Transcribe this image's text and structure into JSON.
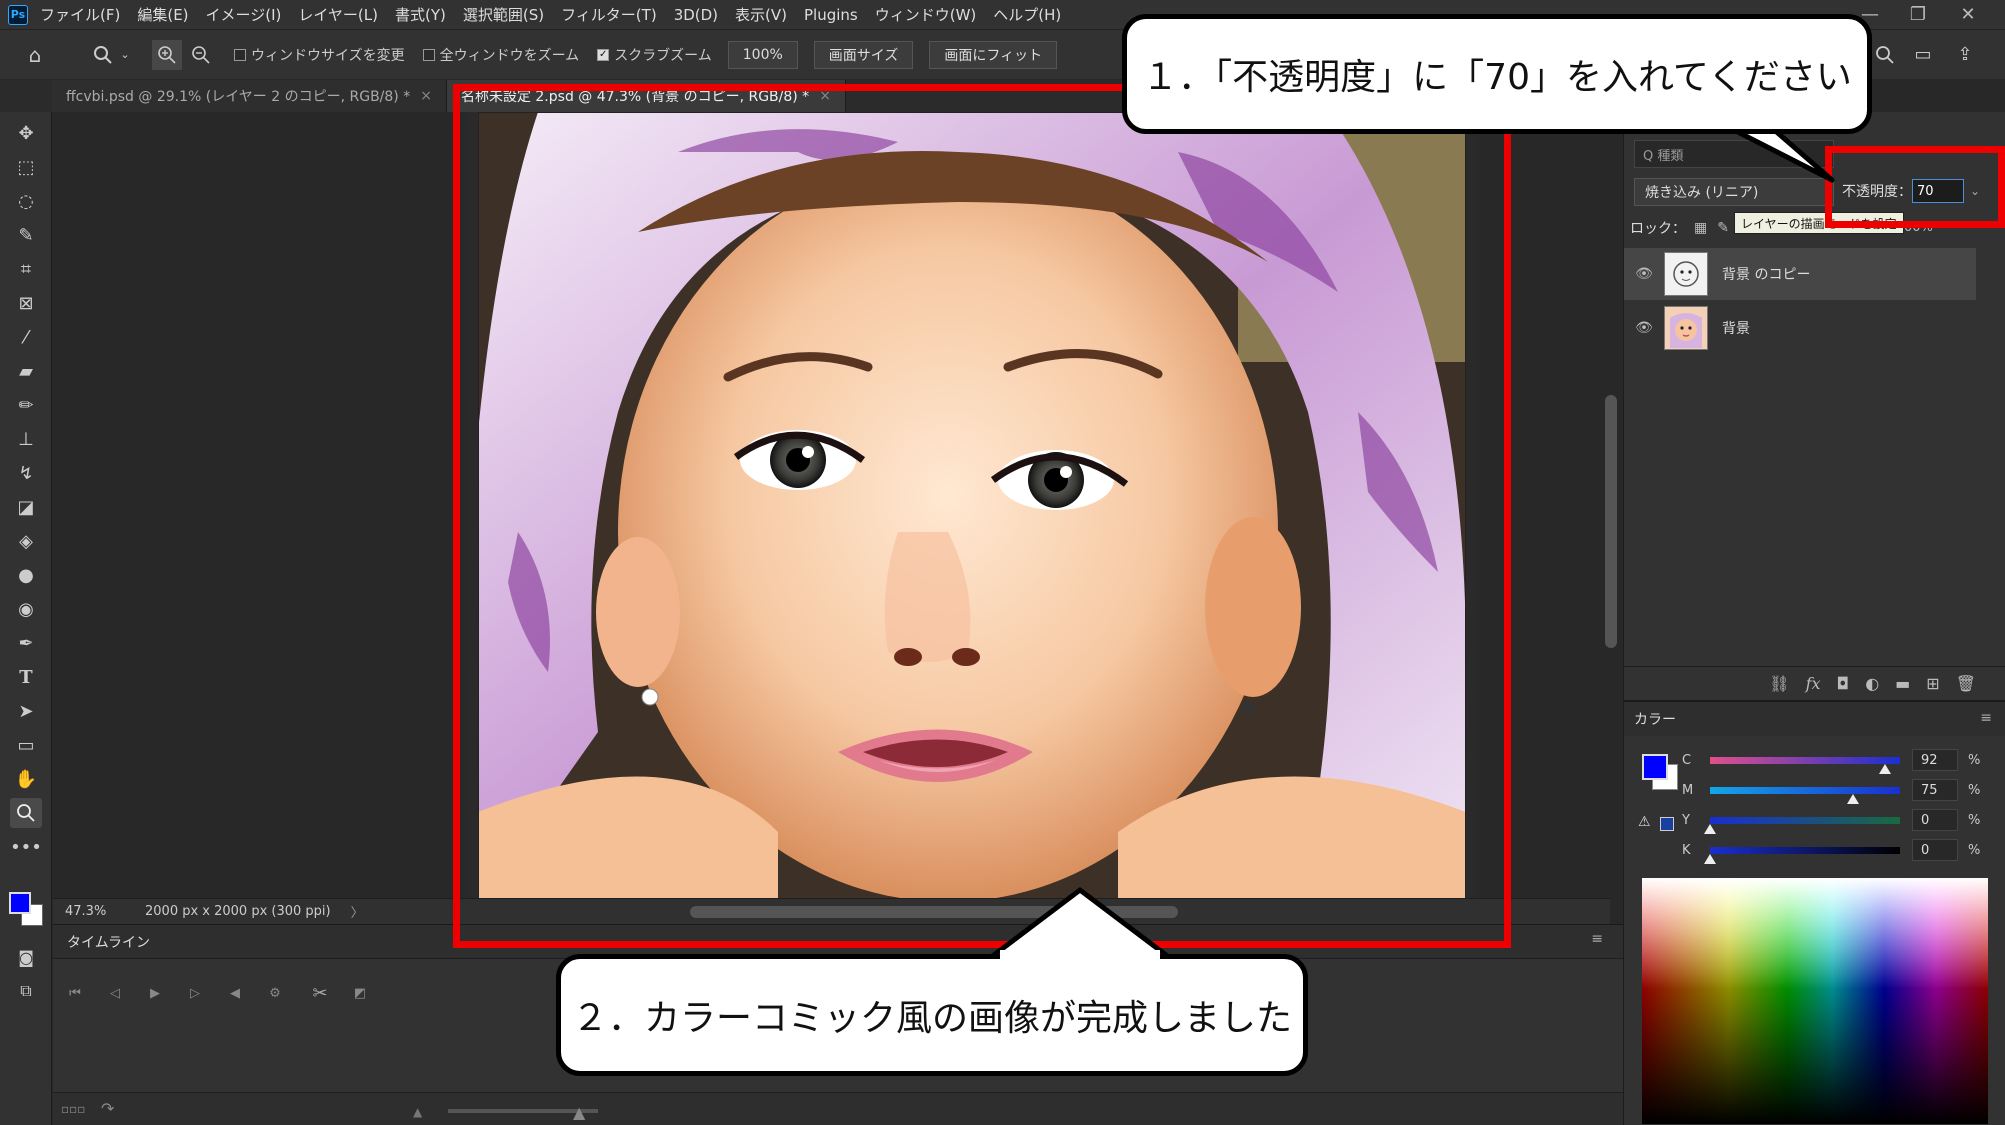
{
  "menubar": {
    "logo": "Ps",
    "items": [
      "ファイル(F)",
      "編集(E)",
      "イメージ(I)",
      "レイヤー(L)",
      "書式(Y)",
      "選択範囲(S)",
      "フィルター(T)",
      "3D(D)",
      "表示(V)",
      "Plugins",
      "ウィンドウ(W)",
      "ヘルプ(H)"
    ]
  },
  "options": {
    "resize_windows": "ウィンドウサイズを変更",
    "zoom_all": "全ウィンドウをズーム",
    "scrubby_zoom": "スクラブズーム",
    "zoom_value": "100%",
    "fit_screen_btn": "画面サイズ",
    "fill_screen_btn": "画面にフィット"
  },
  "tabs": [
    {
      "label": "ffcvbi.psd @ 29.1% (レイヤー 2 のコピー, RGB/8) *",
      "close": "×"
    },
    {
      "label": "名称未設定 2.psd @ 47.3% (背景 のコピー, RGB/8) *",
      "close": "×"
    }
  ],
  "status": {
    "zoom": "47.3%",
    "doc_size": "2000 px x 2000 px (300 ppi)",
    "arrow": "〉"
  },
  "timeline": {
    "title": "タイムライン"
  },
  "layers_panel": {
    "search_placeholder": "Q 種類",
    "blend_mode": "焼き込み (リニア)",
    "opacity_label": "不透明度：",
    "opacity_value": "70",
    "lock_label": "ロック：",
    "fill_value": "00%",
    "tooltip": "レイヤーの描画モードを設定",
    "layers": [
      {
        "name": "背景 のコピー",
        "visible": true,
        "selected": true
      },
      {
        "name": "背景",
        "visible": true,
        "selected": false
      }
    ]
  },
  "color_panel": {
    "title": "カラー",
    "sliders": [
      {
        "label": "C",
        "value": "92",
        "unit": "%",
        "level": 0.92
      },
      {
        "label": "M",
        "value": "75",
        "unit": "%",
        "level": 0.75
      },
      {
        "label": "Y",
        "value": "0",
        "unit": "%",
        "level": 0.0
      },
      {
        "label": "K",
        "value": "0",
        "unit": "%",
        "level": 0.0
      }
    ],
    "foreground": "#0000ff",
    "background": "#ffffff"
  },
  "annotations": {
    "callout1": "１．「不透明度」に「70」を入れてください",
    "callout2": "２．カラーコミック風の画像が完成しました",
    "highlight_color": "#ef0000"
  }
}
